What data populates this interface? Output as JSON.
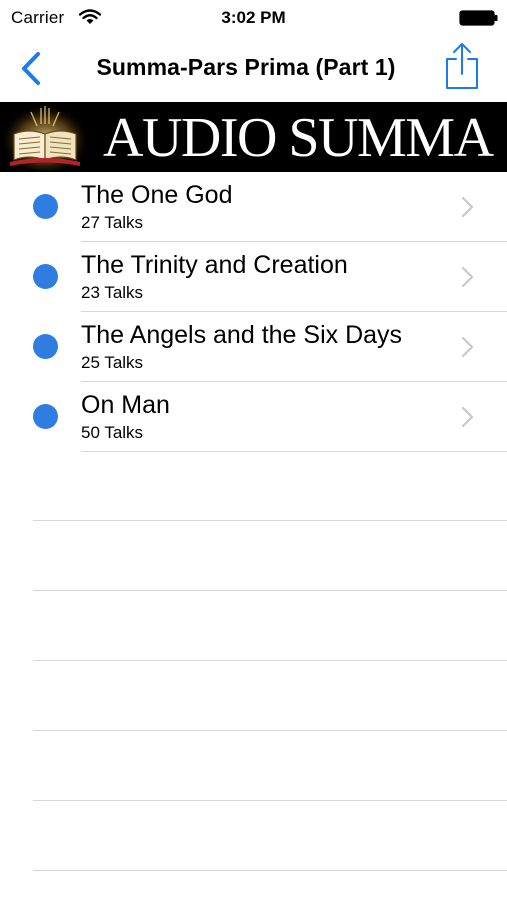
{
  "status_bar": {
    "carrier": "Carrier",
    "time": "3:02 PM"
  },
  "nav": {
    "title": "Summa-Pars Prima (Part 1)",
    "accent_color": "#1a7af2"
  },
  "banner": {
    "text": "AUDIO SUMMA"
  },
  "list": {
    "dot_color": "#2f7de1",
    "items": [
      {
        "title": "The One God",
        "subtitle": "27 Talks"
      },
      {
        "title": "The Trinity and Creation",
        "subtitle": "23 Talks"
      },
      {
        "title": "The Angels and the Six Days",
        "subtitle": "25 Talks"
      },
      {
        "title": "On Man",
        "subtitle": "50 Talks"
      }
    ]
  }
}
